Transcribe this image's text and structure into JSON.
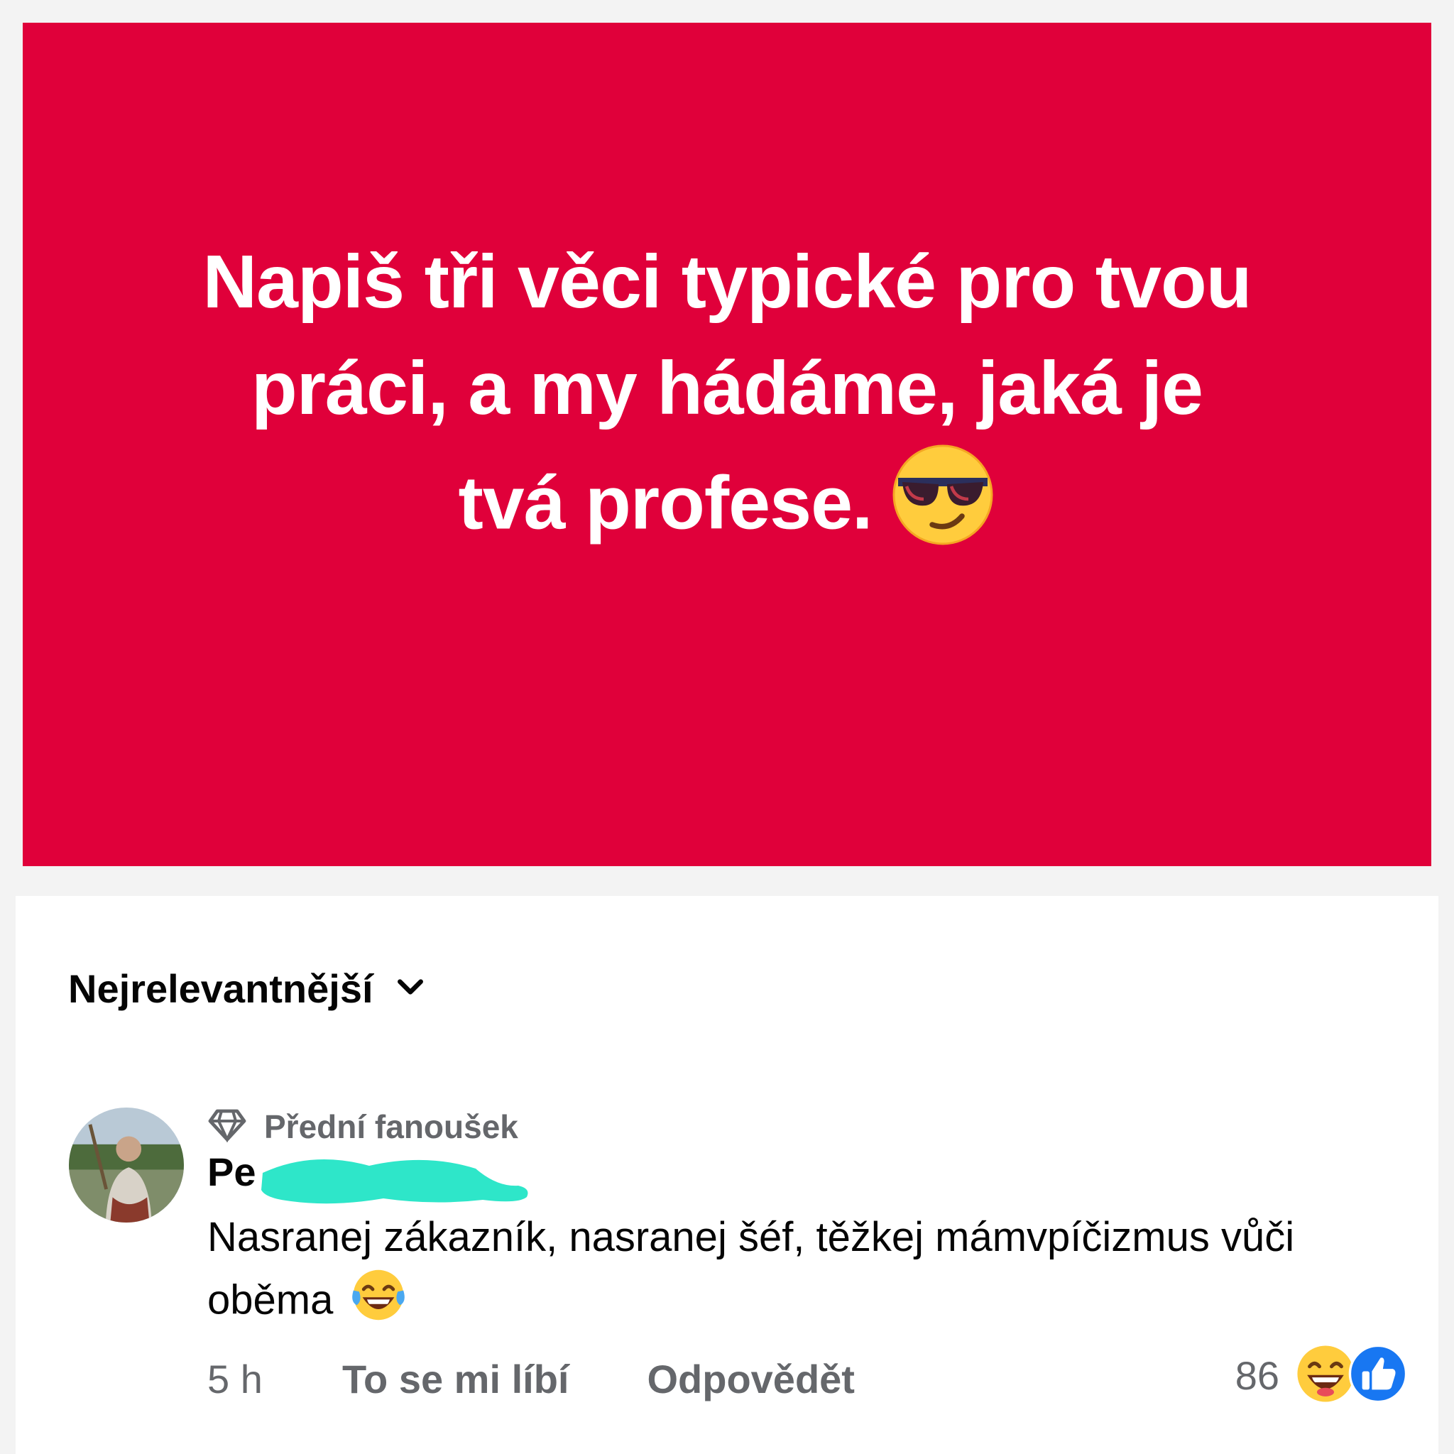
{
  "post": {
    "text_line1": "Napiš tři věci typické pro tvou",
    "text_line2": "práci, a my hádáme, jaká je",
    "text_line3": "tvá profese.",
    "emoji_icon": "sunglasses-face",
    "background_color": "#e0003a"
  },
  "comments": {
    "sort_label": "Nejrelevantnější",
    "comment": {
      "badge": "Přední fanoušek",
      "badge_icon": "diamond",
      "author_name_visible": "Pe",
      "author_redacted": true,
      "text": "Nasranej zákazník, nasranej šéf, těžkej mámvpíčizmus vůči oběma",
      "text_emoji_icon": "tears-of-joy-face",
      "time": "5 h",
      "like_action": "To se mi líbí",
      "reply_action": "Odpovědět",
      "reaction_count": "86",
      "reaction_icons": [
        "laughing-face",
        "thumbs-up"
      ]
    }
  }
}
